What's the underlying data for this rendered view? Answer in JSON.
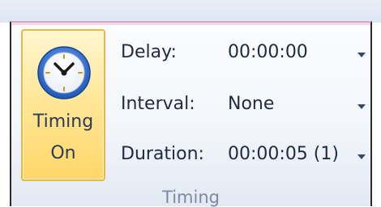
{
  "timing_button": {
    "line1": "Timing",
    "line2": "On",
    "icon": "clock-icon"
  },
  "fields": [
    {
      "label": "Delay:",
      "value": "00:00:00"
    },
    {
      "label": "Interval:",
      "value": "None"
    },
    {
      "label": "Duration:",
      "value": "00:00:05 (1)"
    }
  ],
  "group_label": "Timing",
  "colors": {
    "button_highlight": "#ffd768",
    "button_border": "#e2b94e",
    "clock_face_ring": "#2f6bc7",
    "text": "#1f2b3f",
    "group_label": "#7e8aa0"
  }
}
